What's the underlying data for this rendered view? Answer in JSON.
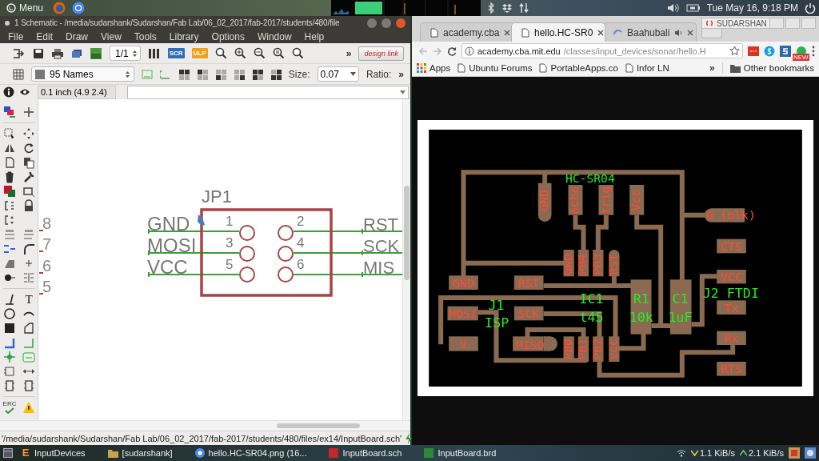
{
  "top_panel": {
    "menu_label": "Menu",
    "clock": "Tue May 16,  9:18 PM"
  },
  "eagle": {
    "title": "1 Schematic - /media/sudarshank/Sudarshan/Fab Lab/06_02_2017/fab-2017/students/480/file",
    "menus": [
      "File",
      "Edit",
      "Draw",
      "View",
      "Tools",
      "Library",
      "Options",
      "Window",
      "Help"
    ],
    "sheet": "1/1",
    "scr_label": "SCR",
    "ulp_label": "ULP",
    "overflow_1": "»",
    "logo": "design link",
    "layer": "95 Names",
    "size_label": "Size:",
    "size_value": "0.07",
    "ratio_label": "Ratio:",
    "overflow_2": "»",
    "coordinates": "0.1 inch (4.9 2.4)",
    "text_tool": "T",
    "erc_label": "ERC",
    "schematic": {
      "row_numbers": [
        "8",
        "7",
        "6",
        "5"
      ],
      "part_name": "JP1",
      "left_pins": [
        "GND",
        "MOSI",
        "VCC"
      ],
      "right_pins": [
        "RST",
        "SCK",
        "MIS"
      ],
      "pin_numbers": [
        "1",
        "2",
        "3",
        "4",
        "5",
        "6"
      ]
    },
    "status": "'/media/sudarshank/Sudarshan/Fab Lab/06_02_2017/fab-2017/students/480/files/ex14/InputBoard.sch'"
  },
  "browser": {
    "profile": "SUDARSHAN",
    "tabs": [
      {
        "title": "academy.cba",
        "selected": false,
        "audio": false
      },
      {
        "title": "hello.HC-SR0",
        "selected": true,
        "audio": false
      },
      {
        "title": "Baahubali",
        "selected": false,
        "audio": true
      }
    ],
    "url_host": "academy.cba.mit.edu",
    "url_path": "/classes/input_devices/sonar/hello.H",
    "extension_badge": "NEW",
    "bookmarks": [
      "Apps",
      "Ubuntu Forums",
      "PortableApps.co",
      "Infor LN"
    ],
    "bookmarks_overflow": "»",
    "other_bookmarks": "Other bookmarks",
    "pcb": {
      "pad_labels": [
        "GND",
        "echo",
        "trig",
        "Vcc",
        "G (blk)",
        "CTS",
        "GND",
        "PB4",
        "PB3",
        "RST",
        "GND",
        "RST",
        "VCC",
        "MOSI",
        "SCK",
        "Tx",
        "V",
        "MISO",
        "Rx",
        "PB0",
        "PB1",
        "PB2",
        "VCC",
        "RTS"
      ],
      "part_labels": [
        "HC-SR04",
        "J2 FTDI",
        "IC1",
        "R1",
        "C1",
        "J1",
        "t45",
        "10k",
        "1uF",
        "ISP"
      ]
    }
  },
  "taskbar": {
    "items": [
      {
        "kind": "eagle",
        "badge": "E",
        "label": "InputDevices"
      },
      {
        "kind": "folder",
        "label": "[sudarshank]"
      },
      {
        "kind": "browser",
        "label": "hello.HC-SR04.png (16..."
      },
      {
        "kind": "schematic",
        "label": "InputBoard.sch"
      },
      {
        "kind": "board",
        "label": "InputBoard.brd"
      }
    ],
    "download_rate": "1.1 KiB/s",
    "upload_rate": "2.1 KiB/s"
  }
}
